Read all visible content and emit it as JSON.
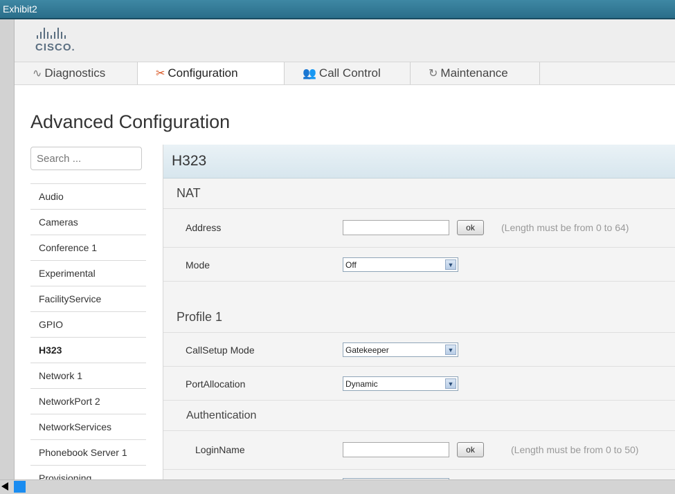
{
  "window": {
    "title": "Exhibit2"
  },
  "header": {
    "logo_text": "CISCO.",
    "tabs": [
      {
        "label": "Diagnostics",
        "icon": "pulse-icon"
      },
      {
        "label": "Configuration",
        "icon": "tools-icon"
      },
      {
        "label": "Call Control",
        "icon": "people-icon"
      },
      {
        "label": "Maintenance",
        "icon": "refresh-icon"
      }
    ],
    "active_tab": "Configuration"
  },
  "page_title": "Advanced Configuration",
  "sidebar": {
    "search_placeholder": "Search ...",
    "items": [
      {
        "label": "Audio"
      },
      {
        "label": "Cameras"
      },
      {
        "label": "Conference 1"
      },
      {
        "label": "Experimental"
      },
      {
        "label": "FacilityService"
      },
      {
        "label": "GPIO"
      },
      {
        "label": "H323"
      },
      {
        "label": "Network 1"
      },
      {
        "label": "NetworkPort 2"
      },
      {
        "label": "NetworkServices"
      },
      {
        "label": "Phonebook Server 1"
      },
      {
        "label": "Provisioning"
      }
    ],
    "active": "H323"
  },
  "panel": {
    "title": "H323",
    "nat": {
      "title": "NAT",
      "address_label": "Address",
      "address_value": "",
      "ok_label": "ok",
      "address_hint": "(Length must be from 0 to 64)",
      "mode_label": "Mode",
      "mode_value": "Off"
    },
    "profile": {
      "title": "Profile 1",
      "callsetup_label": "CallSetup Mode",
      "callsetup_value": "Gatekeeper",
      "port_label": "PortAllocation",
      "port_value": "Dynamic",
      "auth_title": "Authentication",
      "login_label": "LoginName",
      "login_value": "",
      "ok_label": "ok",
      "login_hint": "(Length must be from 0 to 50)"
    }
  },
  "colors": {
    "accent": "#d9531e",
    "titlebar": "#2a6e8a",
    "scroll_thumb": "#1a8cf0"
  }
}
